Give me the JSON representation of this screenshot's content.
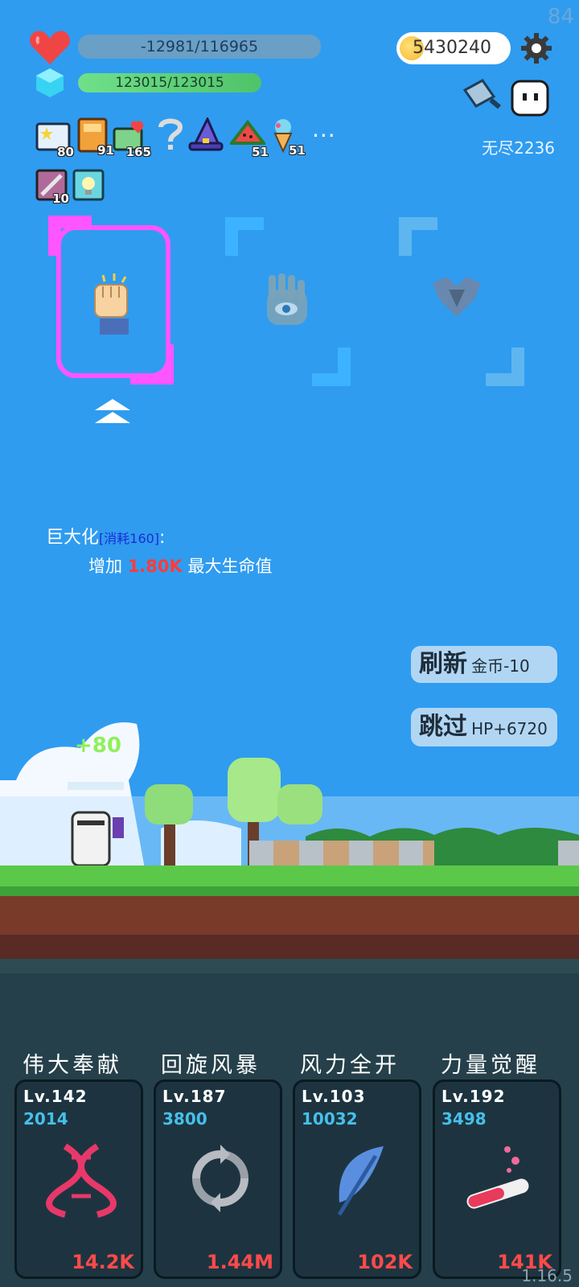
{
  "fps": "84",
  "hp": "-12981/116965",
  "mp": "123015/123015",
  "coins": "5430240",
  "endless": "无尽2236",
  "items": [
    {
      "icon": "star-card-icon",
      "count": "80"
    },
    {
      "icon": "book-icon",
      "count": "91"
    },
    {
      "icon": "heart-card-icon",
      "count": "165"
    },
    {
      "icon": "question-icon",
      "count": ""
    },
    {
      "icon": "wizard-hat-icon",
      "count": ""
    },
    {
      "icon": "watermelon-icon",
      "count": "51"
    },
    {
      "icon": "ice-cream-icon",
      "count": "51"
    }
  ],
  "items2": [
    {
      "icon": "sword-card-icon",
      "count": "10"
    },
    {
      "icon": "bulb-card-icon",
      "count": ""
    }
  ],
  "choices": [
    "fist-icon",
    "eye-hand-icon",
    "armor-icon"
  ],
  "desc": {
    "name": "巨大化",
    "cost": "[消耗160]",
    "colon": ":",
    "prefix": "增加 ",
    "value": "1.80K",
    "suffix": " 最大生命值"
  },
  "refresh": {
    "label": "刷新",
    "sub": "金币-10"
  },
  "skip": {
    "label": "跳过",
    "sub": "HP+6720"
  },
  "float_text": "+80",
  "skills": [
    {
      "title": "伟大奉献",
      "lv": "Lv.142",
      "num": "2014",
      "value": "14.2K",
      "icon": "dna-icon"
    },
    {
      "title": "回旋风暴",
      "lv": "Lv.187",
      "num": "3800",
      "value": "1.44M",
      "icon": "cycle-icon"
    },
    {
      "title": "风力全开",
      "lv": "Lv.103",
      "num": "10032",
      "value": "102K",
      "icon": "feather-icon"
    },
    {
      "title": "力量觉醒",
      "lv": "Lv.192",
      "num": "3498",
      "value": "141K",
      "icon": "potion-icon"
    }
  ],
  "version": "1.16.5",
  "colors": {
    "sky": "#2f9cf0",
    "select": "#ff55ff",
    "danger": "#ff4a4a",
    "accent": "#46c0ea"
  }
}
